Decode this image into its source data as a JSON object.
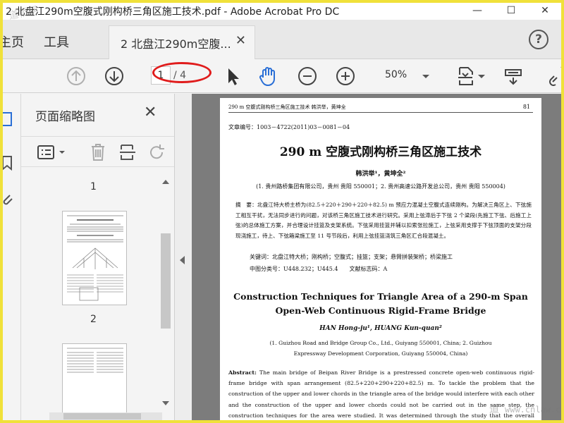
{
  "window": {
    "title": "2 北盘江290m空腹式刚构桥三角区施工技术.pdf - Adobe Acrobat Pro DC"
  },
  "tabs": {
    "home_label": "主页",
    "tools_label": "工具",
    "document_tab_label": "2 北盘江290m空腹...",
    "help_label": "?"
  },
  "toolbar": {
    "current_page": "1",
    "page_total": "/ 4",
    "zoom": "50%"
  },
  "thumbnail_panel": {
    "title": "页面缩略图",
    "page_labels": [
      "1",
      "2"
    ]
  },
  "paper": {
    "header_left": "290 m 空腹式刚构桥三角区施工技术     韩洪举，黄坤全",
    "header_page": "81",
    "article_no": "文章编号：1003－4722(2011)03－0081－04",
    "cn_title": "290 m 空腹式刚构桥三角区施工技术",
    "cn_authors": "韩洪举¹，黄坤全²",
    "cn_affiliation": "(1. 贵州路桥集团有限公司，贵州 贵阳 550001；2. 贵州高速公路开发总公司，贵州 贵阳 550004)",
    "cn_abstract": "摘　要：北盘江特大桥主桥为(82.5＋220＋290＋220＋82.5) m 预应力混凝土空腹式连续刚构。为解决三角区上、下弦施工相互干扰，无法同步进行的问题，对该桥三角区施工技术进行研究。采用上弦滞后于下弦 2 个梁段(先施工下弦、后施工上弦)的总体施工方案，并合理设计挂篮及支架系统。下弦采用挂篮并辅以扣索张拉施工，上弦采用支撑于下弦顶面的支架分段现浇施工，待上、下弦箱梁施工至 11 号节段后，利用上弦挂篮浇筑三角区汇合段混凝土。",
    "keywords": "关键词：北盘江特大桥；刚构桥；空腹式；挂篮；支架；悬臂拼装架桥；桥梁施工",
    "classification": "中图分类号：U448.232；U445.4　　文献标志码：A",
    "en_title": "Construction Techniques for Triangle Area of a 290-m Span Open-Web Continuous Rigid-Frame Bridge",
    "en_authors": "HAN Hong-ju¹, HUANG Kun-quan²",
    "en_affiliation": "(1. Guizhou Road and Bridge Group Co., Ltd., Guiyang 550001, China; 2. Guizhou Expressway Development Corporation, Guiyang 550004, China)",
    "en_abstract_label": "Abstract:",
    "en_abstract": " The main bridge of Beipan River Bridge is a prestressed concrete open-web continuous rigid-frame bridge with span arrangement (82.5+220+290+220+82.5) m. To tackle the problem that the construction of the upper and lower chords in the triangle area of the bridge would interfere with each other and the construction of the upper and lower chords could not be carried out in the same step, the construction techniques for the area were studied. It was determined through the study that the overall construction scheme of constructing the upper chord two"
  },
  "watermarks": {
    "top_left": "道桥网",
    "bottom_right_cn": "道",
    "bottom_right_url": "www.cnlaw.com"
  }
}
